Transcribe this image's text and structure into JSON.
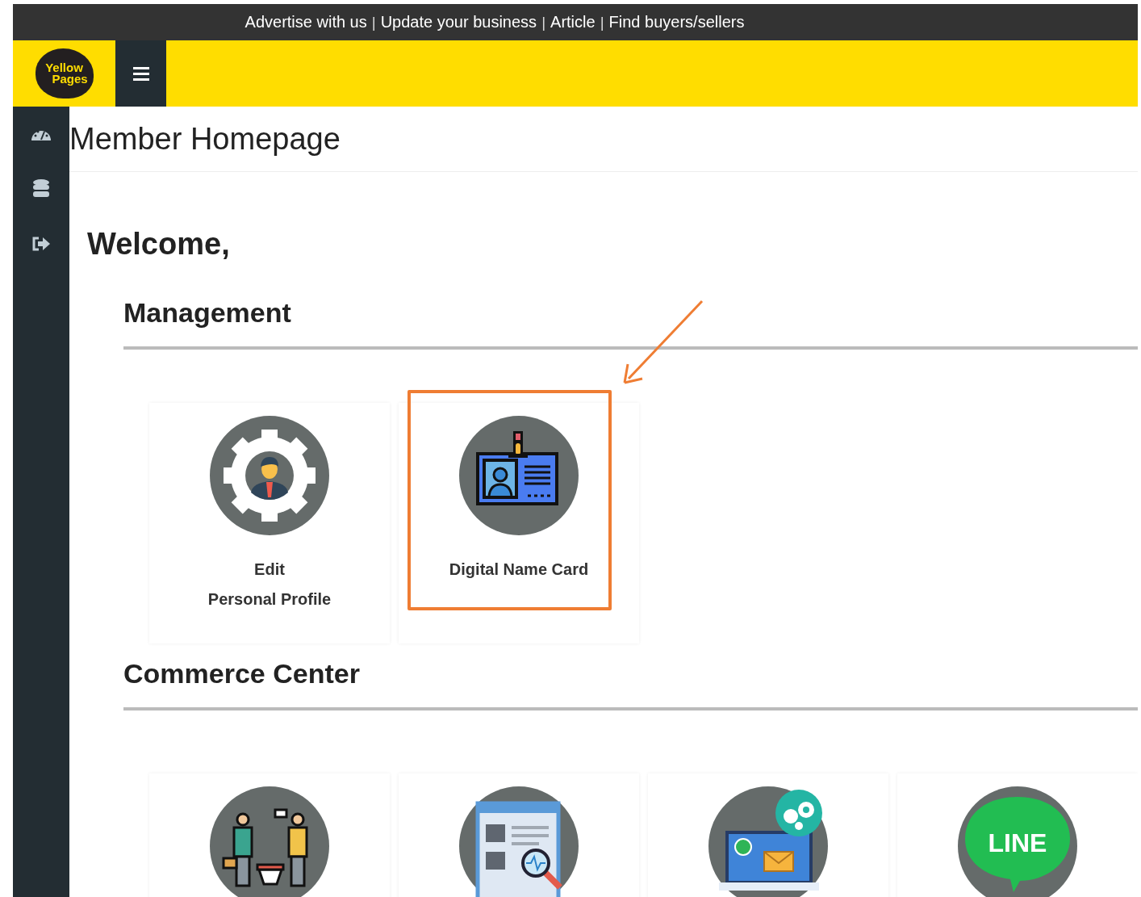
{
  "top_links": [
    {
      "kind": "link",
      "text": "Advertise with us"
    },
    {
      "kind": "separator",
      "text": "|"
    },
    {
      "kind": "link",
      "text": "Update your business"
    },
    {
      "kind": "separator",
      "text": "|"
    },
    {
      "kind": "link",
      "text": "Article"
    },
    {
      "kind": "separator",
      "text": "|"
    },
    {
      "kind": "link",
      "text": "Find buyers/sellers"
    }
  ],
  "logo": {
    "line_1": "Yellow",
    "line_2": "Pages"
  },
  "sidebar": {
    "items": [
      {
        "kind": "dashboard"
      },
      {
        "kind": "database"
      },
      {
        "kind": "logout"
      }
    ]
  },
  "page_title": "Member Homepage",
  "welcome": "Welcome,",
  "sections": [
    {
      "title": "Management",
      "cards": [
        {
          "kind": "profile",
          "lines": [
            "Edit",
            "Personal Profile"
          ],
          "highlighted": false
        },
        {
          "kind": "namecard",
          "lines": [
            "Digital Name Card"
          ],
          "highlighted": true
        }
      ]
    },
    {
      "title": "Commerce Center",
      "cards": [
        {
          "kind": "buyers",
          "highlighted": false
        },
        {
          "kind": "browser",
          "highlighted": false
        },
        {
          "kind": "messaging",
          "highlighted": false
        },
        {
          "kind": "line",
          "icon_text": "LINE",
          "highlighted": false
        }
      ]
    }
  ]
}
